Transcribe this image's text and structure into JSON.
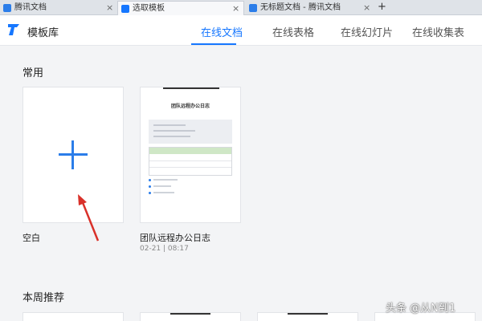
{
  "tabs": [
    {
      "label": "腾讯文档",
      "close": "×"
    },
    {
      "label": "选取模板",
      "close": "×"
    },
    {
      "label": "无标题文档 - 腾讯文档",
      "close": "×"
    }
  ],
  "new_tab": "+",
  "header": {
    "title": "模板库",
    "nav": [
      "在线文档",
      "在线表格",
      "在线幻灯片",
      "在线收集表"
    ]
  },
  "sections": {
    "common": "常用",
    "weekly": "本周推荐"
  },
  "cards": {
    "blank": {
      "label": "空白"
    },
    "template": {
      "label": "团队远程办公日志",
      "meta": "02-21 | 08:17",
      "preview_title": "团队远程办公日志"
    }
  },
  "watermark": "头条 @从N到1",
  "colors": {
    "accent": "#1677ff",
    "plus": "#2b7de9",
    "arrow": "#d9312a"
  }
}
